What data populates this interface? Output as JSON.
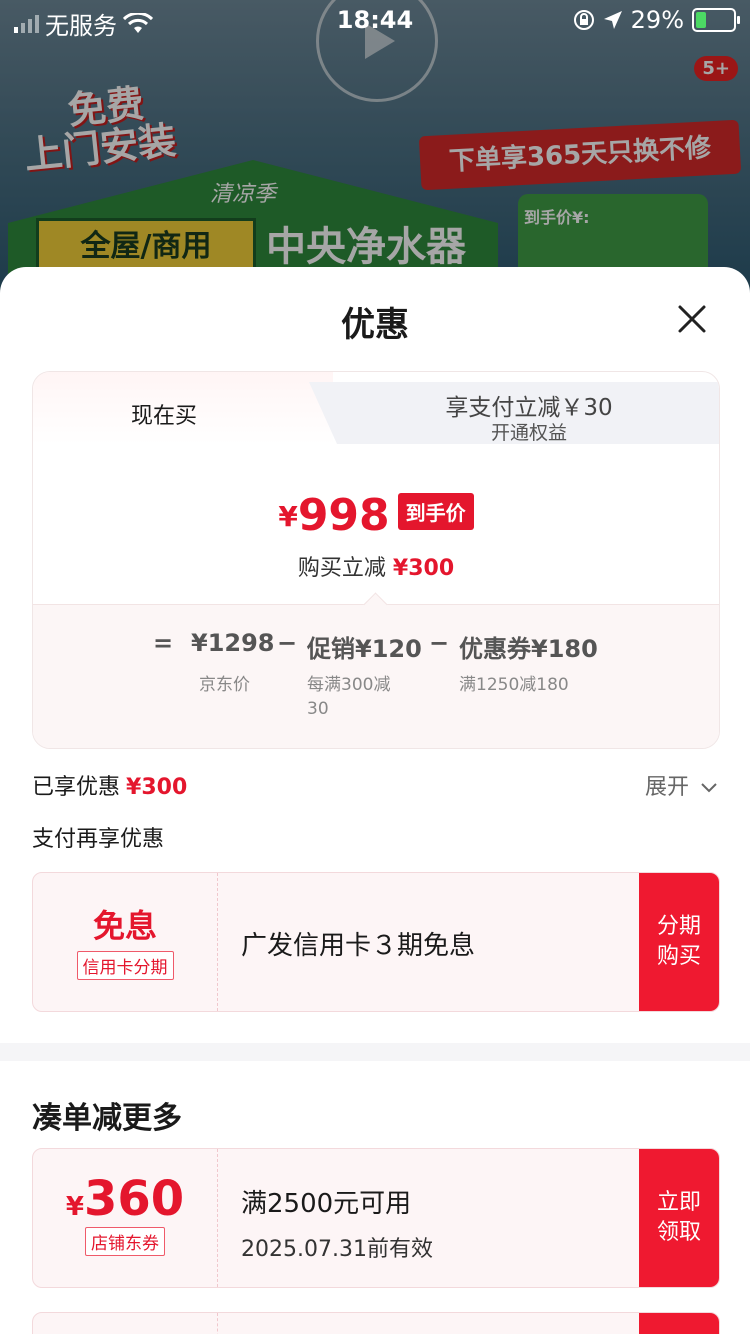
{
  "status_bar": {
    "carrier": "无服务",
    "time": "18:44",
    "battery": "29%"
  },
  "background": {
    "free_install": [
      "免费",
      "上门安装"
    ],
    "replace_promo": "下单享365天只换不修",
    "season": "清凉季",
    "whole_house": "全屋/商用",
    "central": "中央净水器",
    "price_label": "到手价¥:",
    "badge": "5+"
  },
  "sheet": {
    "title": "优惠"
  },
  "tabs": {
    "now": "现在买",
    "pay_title": "享支付立减￥30",
    "pay_sub": "开通权益"
  },
  "price": {
    "currency": "¥",
    "final": "998",
    "final_tag": "到手价",
    "reduce_label": "购买立减",
    "reduce_value": "¥300"
  },
  "breakdown": {
    "eq": "=",
    "jd_price": "¥1298",
    "jd_label": "京东价",
    "minus1": "−",
    "promo": "促销¥120",
    "promo_desc": "每满300减30",
    "minus2": "−",
    "coupon": "优惠券¥180",
    "coupon_desc": "满1250减180"
  },
  "enjoyed": {
    "label": "已享优惠",
    "value": "¥300",
    "expand": "展开"
  },
  "pay_more": {
    "label": "支付再享优惠"
  },
  "installment": {
    "title": "免息",
    "tag": "信用卡分期",
    "desc": "广发信用卡３期免息",
    "button": "分期购买"
  },
  "more": {
    "heading": "凑单减更多",
    "coupon": {
      "currency": "¥",
      "amount": "360",
      "tag": "店铺东券",
      "condition": "满2500元可用",
      "expiry": "2025.07.31前有效",
      "button": "立即领取"
    }
  }
}
